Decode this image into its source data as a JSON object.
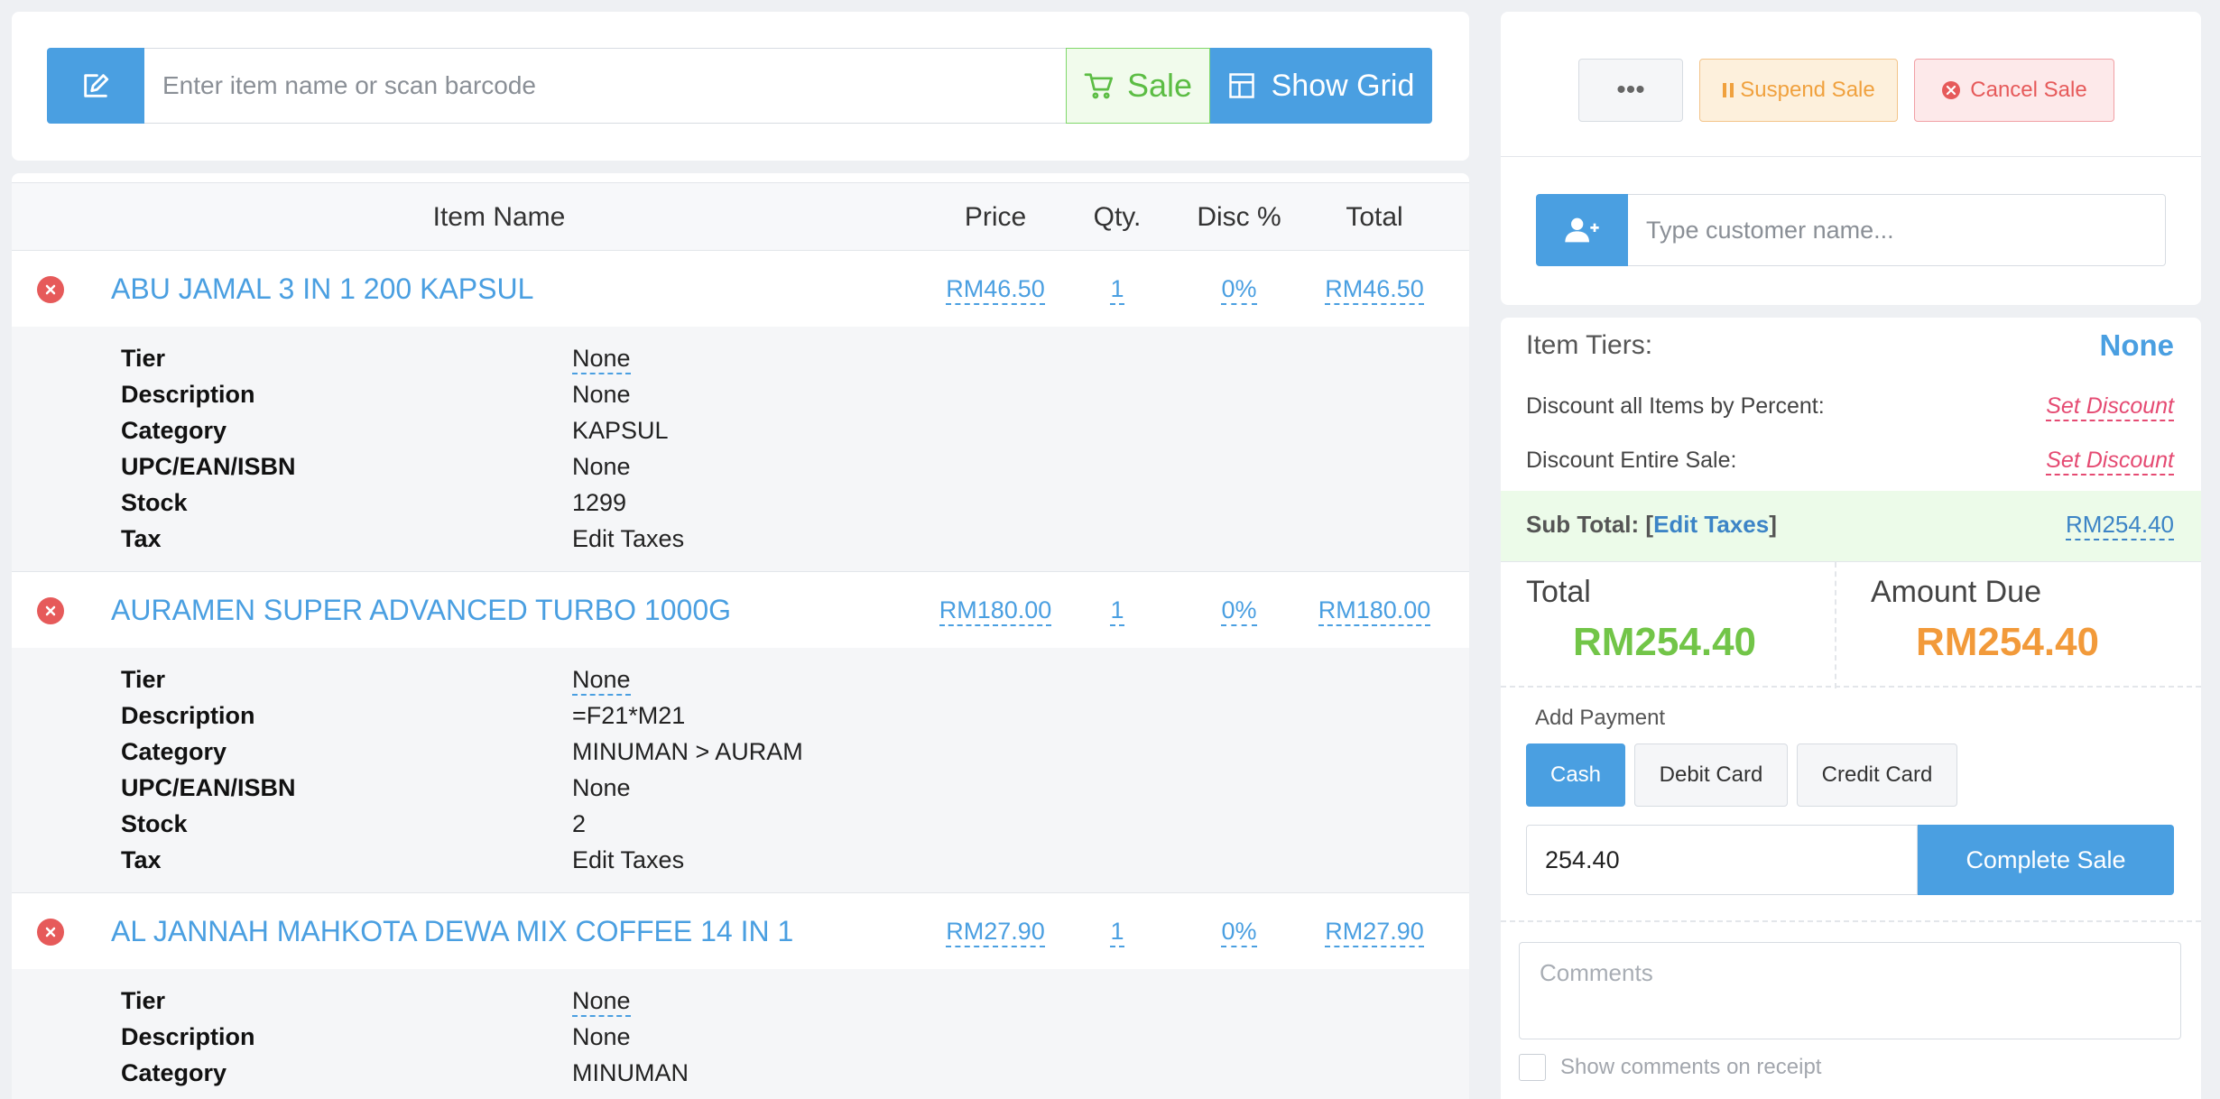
{
  "search": {
    "placeholder": "Enter item name or scan barcode",
    "sale_label": "Sale",
    "show_grid_label": "Show Grid"
  },
  "table": {
    "headers": {
      "item_name": "Item Name",
      "price": "Price",
      "qty": "Qty.",
      "disc": "Disc %",
      "total": "Total"
    }
  },
  "detail_labels": {
    "tier": "Tier",
    "description": "Description",
    "category": "Category",
    "upc": "UPC/EAN/ISBN",
    "stock": "Stock",
    "tax": "Tax"
  },
  "items": [
    {
      "name": "ABU JAMAL 3 IN 1 200 KAPSUL",
      "price": "RM46.50",
      "qty": "1",
      "disc": "0%",
      "total": "RM46.50",
      "tier": "None",
      "description": "None",
      "category": "KAPSUL",
      "upc": "None",
      "stock": "1299",
      "tax": "Edit Taxes"
    },
    {
      "name": "AURAMEN SUPER ADVANCED TURBO 1000G",
      "price": "RM180.00",
      "qty": "1",
      "disc": "0%",
      "total": "RM180.00",
      "tier": "None",
      "description": "=F21*M21",
      "category": "MINUMAN > AURAM",
      "upc": "None",
      "stock": "2",
      "tax": "Edit Taxes"
    },
    {
      "name": "AL JANNAH MAHKOTA DEWA MIX COFFEE 14 IN 1",
      "price": "RM27.90",
      "qty": "1",
      "disc": "0%",
      "total": "RM27.90",
      "tier": "None",
      "description": "None",
      "category": "MINUMAN"
    }
  ],
  "actions": {
    "more_label": "•••",
    "suspend_label": "Suspend Sale",
    "cancel_label": "Cancel Sale"
  },
  "customer": {
    "placeholder": "Type customer name..."
  },
  "summary": {
    "item_tiers_label": "Item Tiers:",
    "item_tiers_value": "None",
    "discount_percent_label": "Discount all Items by Percent:",
    "discount_entire_label": "Discount Entire Sale:",
    "set_discount_label": "Set Discount",
    "subtotal_label": "Sub Total:",
    "edit_taxes_label": "Edit Taxes",
    "subtotal_value": "RM254.40",
    "total_label": "Total",
    "total_value": "RM254.40",
    "amount_due_label": "Amount Due",
    "amount_due_value": "RM254.40"
  },
  "payment": {
    "add_payment_label": "Add Payment",
    "methods": [
      "Cash",
      "Debit Card",
      "Credit Card"
    ],
    "selected_method": "Cash",
    "amount_value": "254.40",
    "complete_label": "Complete Sale"
  },
  "comments": {
    "placeholder": "Comments",
    "show_on_receipt_label": "Show comments on receipt"
  },
  "colors": {
    "primary": "#4a9fe1",
    "sale_green": "#5cbd44",
    "total_green": "#72c548",
    "amount_due_orange": "#f29a3a",
    "danger": "#e65a5a",
    "discount_pink": "#e54a72"
  }
}
